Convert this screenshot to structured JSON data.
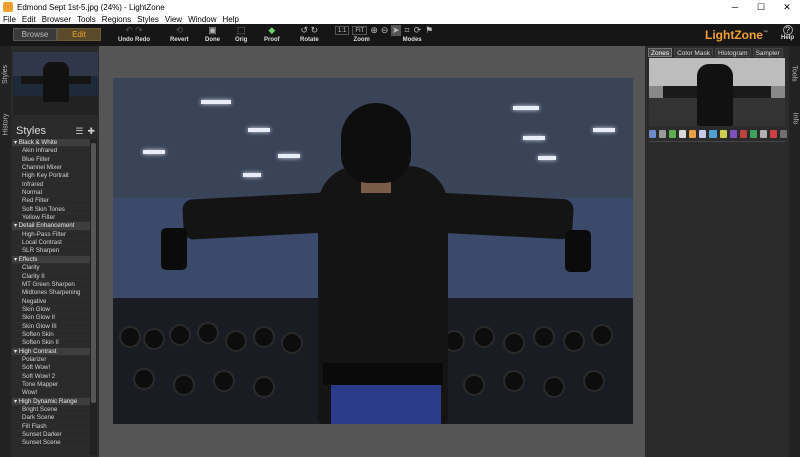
{
  "window": {
    "title": "Edmond Sept 1st-5.jpg (24%) - LightZone",
    "minimize": "─",
    "maximize": "☐",
    "close": "✕"
  },
  "menu": [
    "File",
    "Edit",
    "Browser",
    "Tools",
    "Regions",
    "Styles",
    "View",
    "Window",
    "Help"
  ],
  "toolbar": {
    "browse_label": "Browse",
    "edit_label": "Edit",
    "undo_redo_label": "Undo Redo",
    "revert_label": "Revert",
    "done_label": "Done",
    "orig_label": "Orig",
    "proof_label": "Proof",
    "rotate_label": "Rotate",
    "zoom_label": "Zoom",
    "zoom_1to1": "1:1",
    "zoom_fit": "FIT",
    "modes_label": "Modes",
    "help_label": "Help",
    "brand": "LightZone",
    "brand_tm": "™"
  },
  "left_vtabs": {
    "styles": "Styles",
    "history": "History"
  },
  "right_vtabs": {
    "tools": "Tools",
    "info": "Info"
  },
  "styles_panel": {
    "title": "Styles",
    "list_icon": "list-icon",
    "add_icon": "plus-icon",
    "items": [
      {
        "label": "Black & White",
        "category": true
      },
      {
        "label": "Akin Infrared",
        "category": false
      },
      {
        "label": "Blue Filter",
        "category": false
      },
      {
        "label": "Channel Mixer",
        "category": false
      },
      {
        "label": "High Key Portrait",
        "category": false
      },
      {
        "label": "Infrared",
        "category": false
      },
      {
        "label": "Normal",
        "category": false
      },
      {
        "label": "Red Filter",
        "category": false
      },
      {
        "label": "Soft Skin Tones",
        "category": false
      },
      {
        "label": "Yellow Filter",
        "category": false
      },
      {
        "label": "Detail Enhancement",
        "category": true
      },
      {
        "label": "High-Pass Filter",
        "category": false
      },
      {
        "label": "Local Contrast",
        "category": false
      },
      {
        "label": "SLR Sharpen",
        "category": false
      },
      {
        "label": "Effects",
        "category": true
      },
      {
        "label": "Clarity",
        "category": false
      },
      {
        "label": "Clarity II",
        "category": false
      },
      {
        "label": "MT Green Sharpen",
        "category": false
      },
      {
        "label": "Midtones Sharpening",
        "category": false
      },
      {
        "label": "Negative",
        "category": false
      },
      {
        "label": "Skin Glow",
        "category": false
      },
      {
        "label": "Skin Glow II",
        "category": false
      },
      {
        "label": "Skin Glow III",
        "category": false
      },
      {
        "label": "Soften Skin",
        "category": false
      },
      {
        "label": "Soften Skin II",
        "category": false
      },
      {
        "label": "High Contrast",
        "category": true
      },
      {
        "label": "Polarizer",
        "category": false
      },
      {
        "label": "Soft Wow!",
        "category": false
      },
      {
        "label": "Soft Wow! 2",
        "category": false
      },
      {
        "label": "Tone Mapper",
        "category": false
      },
      {
        "label": "Wow!",
        "category": false
      },
      {
        "label": "High Dynamic Range",
        "category": true
      },
      {
        "label": "Bright Scene",
        "category": false
      },
      {
        "label": "Dark Scene",
        "category": false
      },
      {
        "label": "Fill Flash",
        "category": false
      },
      {
        "label": "Sunset Darker",
        "category": false
      },
      {
        "label": "Sunset Scene",
        "category": false
      }
    ]
  },
  "right_panel": {
    "tabs": [
      {
        "label": "Zones",
        "active": true
      },
      {
        "label": "Color Mask",
        "active": false
      },
      {
        "label": "Histogram",
        "active": false
      },
      {
        "label": "Sampler",
        "active": false
      }
    ],
    "tool_icon_colors": [
      "#6a8ac8",
      "#9a9a9a",
      "#5ab04a",
      "#d8d8d8",
      "#e8a040",
      "#c8c8e8",
      "#50a0d0",
      "#d0d050",
      "#8050c0",
      "#c04040",
      "#40a060",
      "#b0b0b0",
      "#d04040",
      "#707070"
    ]
  },
  "colors": {
    "accent": "#f0a030",
    "canvas_bg": "#555555",
    "panel_bg": "#2a2a2a"
  }
}
